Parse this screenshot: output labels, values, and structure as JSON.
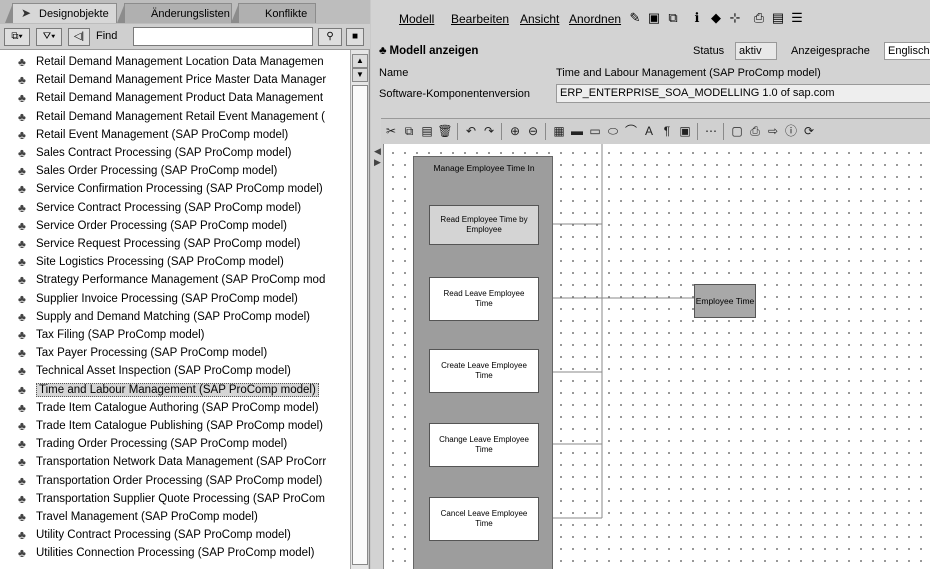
{
  "left_tabs": [
    "Designobjekte",
    "Änderungslisten",
    "Konflikte"
  ],
  "find": {
    "label": "Find",
    "value": ""
  },
  "tree_items": [
    "Retail Demand Management Location Data Managemen",
    "Retail Demand Management Price Master Data Manager",
    "Retail Demand Management Product Data Management",
    "Retail Demand Management Retail Event Management (",
    "Retail Event Management (SAP ProComp model)",
    "Sales Contract Processing (SAP ProComp model)",
    "Sales Order Processing (SAP ProComp model)",
    "Service Confirmation Processing (SAP ProComp model)",
    "Service Contract Processing (SAP ProComp model)",
    "Service Order Processing (SAP ProComp model)",
    "Service Request Processing (SAP ProComp model)",
    "Site Logistics Processing (SAP ProComp model)",
    "Strategy Performance Management (SAP ProComp mod",
    "Supplier Invoice Processing (SAP ProComp model)",
    "Supply and Demand Matching (SAP ProComp model)",
    "Tax Filing (SAP ProComp model)",
    "Tax Payer Processing (SAP ProComp model)",
    "Technical Asset Inspection (SAP ProComp model)",
    "Time and Labour Management (SAP ProComp model)",
    "Trade Item Catalogue Authoring (SAP ProComp model)",
    "Trade Item Catalogue Publishing (SAP ProComp model)",
    "Trading Order Processing (SAP ProComp model)",
    "Transportation Network Data Management (SAP ProCorr",
    "Transportation Order Processing (SAP ProComp model)",
    "Transportation Supplier Quote Processing (SAP ProCom",
    "Travel Management (SAP ProComp model)",
    "Utility Contract Processing (SAP ProComp model)",
    "Utilities Connection Processing (SAP ProComp model)"
  ],
  "selected_index": 18,
  "menu": [
    "Modell",
    "Bearbeiten",
    "Ansicht",
    "Anordnen"
  ],
  "header": {
    "title": "Modell anzeigen",
    "status_label": "Status",
    "status_value": "aktiv",
    "lang_label": "Anzeigesprache",
    "lang_value": "Englisch",
    "name_label": "Name",
    "name_value": "Time and Labour Management (SAP ProComp model)",
    "sw_label": "Software-Komponentenversion",
    "sw_value": "ERP_ENTERPRISE_SOA_MODELLING 1.0 of sap.com"
  },
  "diagram": {
    "pool_title": "Manage Employee Time In",
    "operations": [
      "Read Employee Time by Employee",
      "Read Leave Employee Time",
      "Create Leave Employee Time",
      "Change Leave Employee Time",
      "Cancel Leave Employee Time"
    ],
    "target": "Employee Time"
  }
}
